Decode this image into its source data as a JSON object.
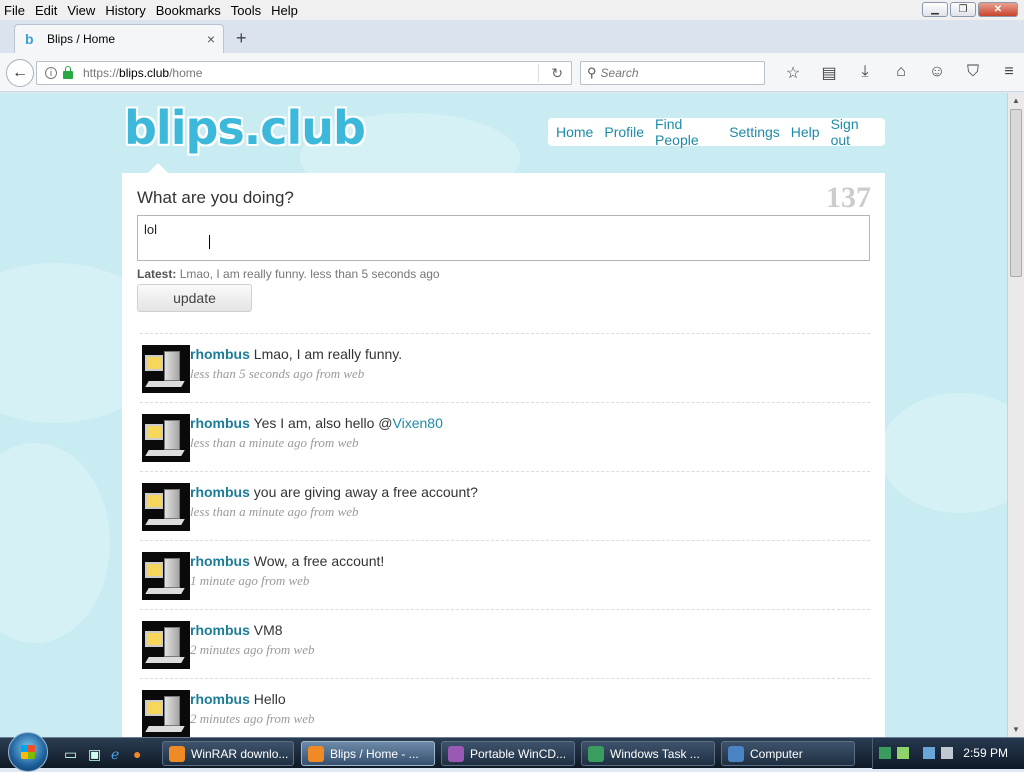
{
  "menu": [
    "File",
    "Edit",
    "View",
    "History",
    "Bookmarks",
    "Tools",
    "Help"
  ],
  "tab": {
    "title": "Blips / Home",
    "favicon": "b",
    "close": "×",
    "new": "+"
  },
  "address": {
    "scheme": "https://",
    "host": "blips.club",
    "path": "/home"
  },
  "search": {
    "placeholder": "Search"
  },
  "site": {
    "logo": "blips.club",
    "nav": [
      "Home",
      "Profile",
      "Find People",
      "Settings",
      "Help",
      "Sign out"
    ]
  },
  "composer": {
    "question": "What are you doing?",
    "counter": "137",
    "value": "lol",
    "latest_label": "Latest:",
    "latest_text": "Lmao, I am really funny. less than 5 seconds ago",
    "update_label": "update"
  },
  "timeline": [
    {
      "user": "rhombus",
      "text": "Lmao, I am really funny.",
      "mention": "",
      "meta": "less than 5 seconds ago from web"
    },
    {
      "user": "rhombus",
      "text": "Yes I am, also hello @",
      "mention": "Vixen80",
      "meta": "less than a minute ago from web"
    },
    {
      "user": "rhombus",
      "text": "you are giving away a free account?",
      "mention": "",
      "meta": "less than a minute ago from web"
    },
    {
      "user": "rhombus",
      "text": "Wow, a free account!",
      "mention": "",
      "meta": "1 minute ago from web"
    },
    {
      "user": "rhombus",
      "text": "VM8",
      "mention": "",
      "meta": "2 minutes ago from web"
    },
    {
      "user": "rhombus",
      "text": "Hello",
      "mention": "",
      "meta": "2 minutes ago from web"
    }
  ],
  "taskbar": {
    "tasks": [
      "WinRAR downlo...",
      "Blips / Home - ...",
      "Portable WinCD...",
      "Windows Task ...",
      "Computer"
    ],
    "clock": "2:59 PM"
  },
  "colors": {
    "accent": "#1d8ba8",
    "background": "#c8ecf2",
    "logo": "#3bb8da"
  }
}
